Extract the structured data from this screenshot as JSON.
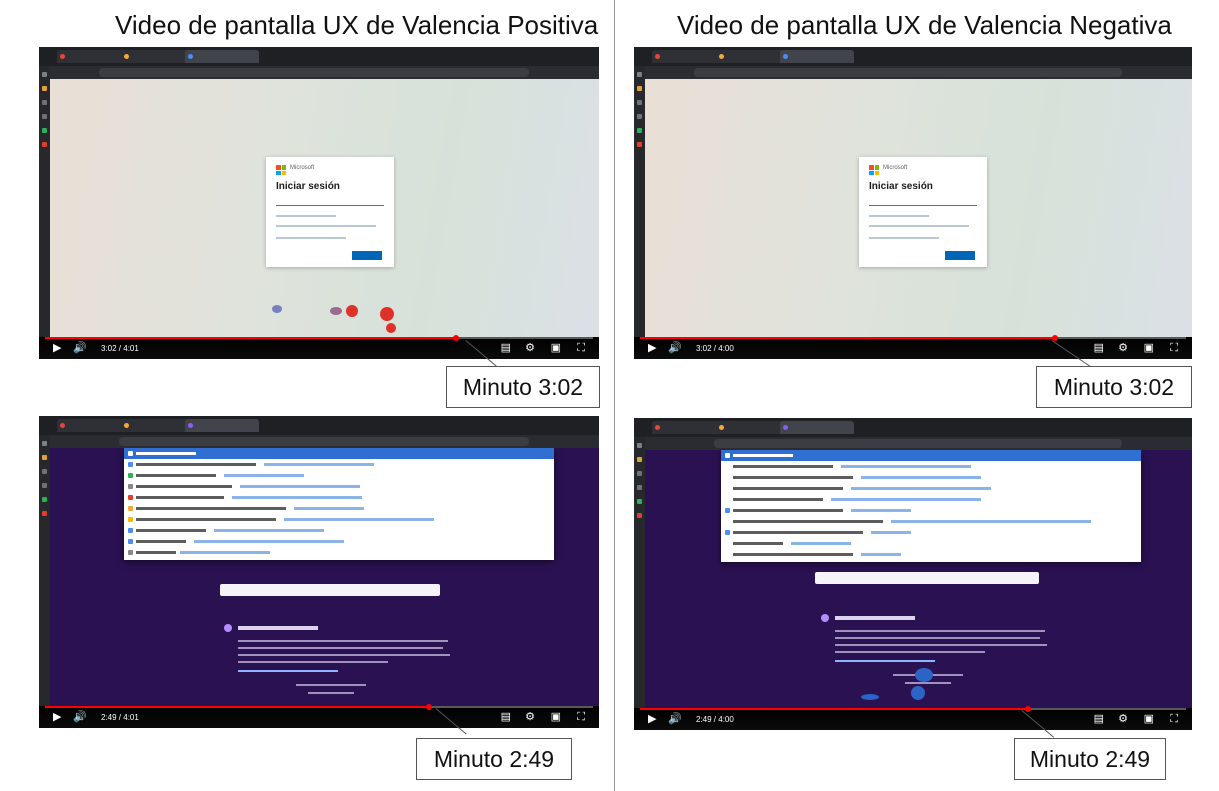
{
  "columns": {
    "left_title": "Video de pantalla UX de Valencia Positiva",
    "right_title": "Video de pantalla UX de Valencia Negativa"
  },
  "videos": {
    "positive_top": {
      "time": "3:02 / 4:01",
      "progress": 0.75,
      "callout": "Minuto 3:02"
    },
    "negative_top": {
      "time": "3:02 / 4:00",
      "progress": 0.76,
      "callout": "Minuto 3:02"
    },
    "positive_bottom": {
      "time": "2:49 / 4:01",
      "progress": 0.7,
      "callout": "Minuto 2:49"
    },
    "negative_bottom": {
      "time": "2:49 / 4:00",
      "progress": 0.71,
      "callout": "Minuto 2:49"
    }
  },
  "login_card": {
    "brand": "Microsoft",
    "title": "Iniciar sesión"
  },
  "colors": {
    "accent_red": "#ff0000",
    "ms_blue": "#0067b8",
    "private_purple": "#2a1151",
    "click_red": "#e0302a",
    "click_blue": "#2c63c7"
  },
  "icons": {
    "play": "play-icon",
    "volume": "volume-icon",
    "subtitles": "subtitles-icon",
    "settings": "gear-icon",
    "miniplayer": "miniplayer-icon",
    "fullscreen": "fullscreen-icon"
  }
}
